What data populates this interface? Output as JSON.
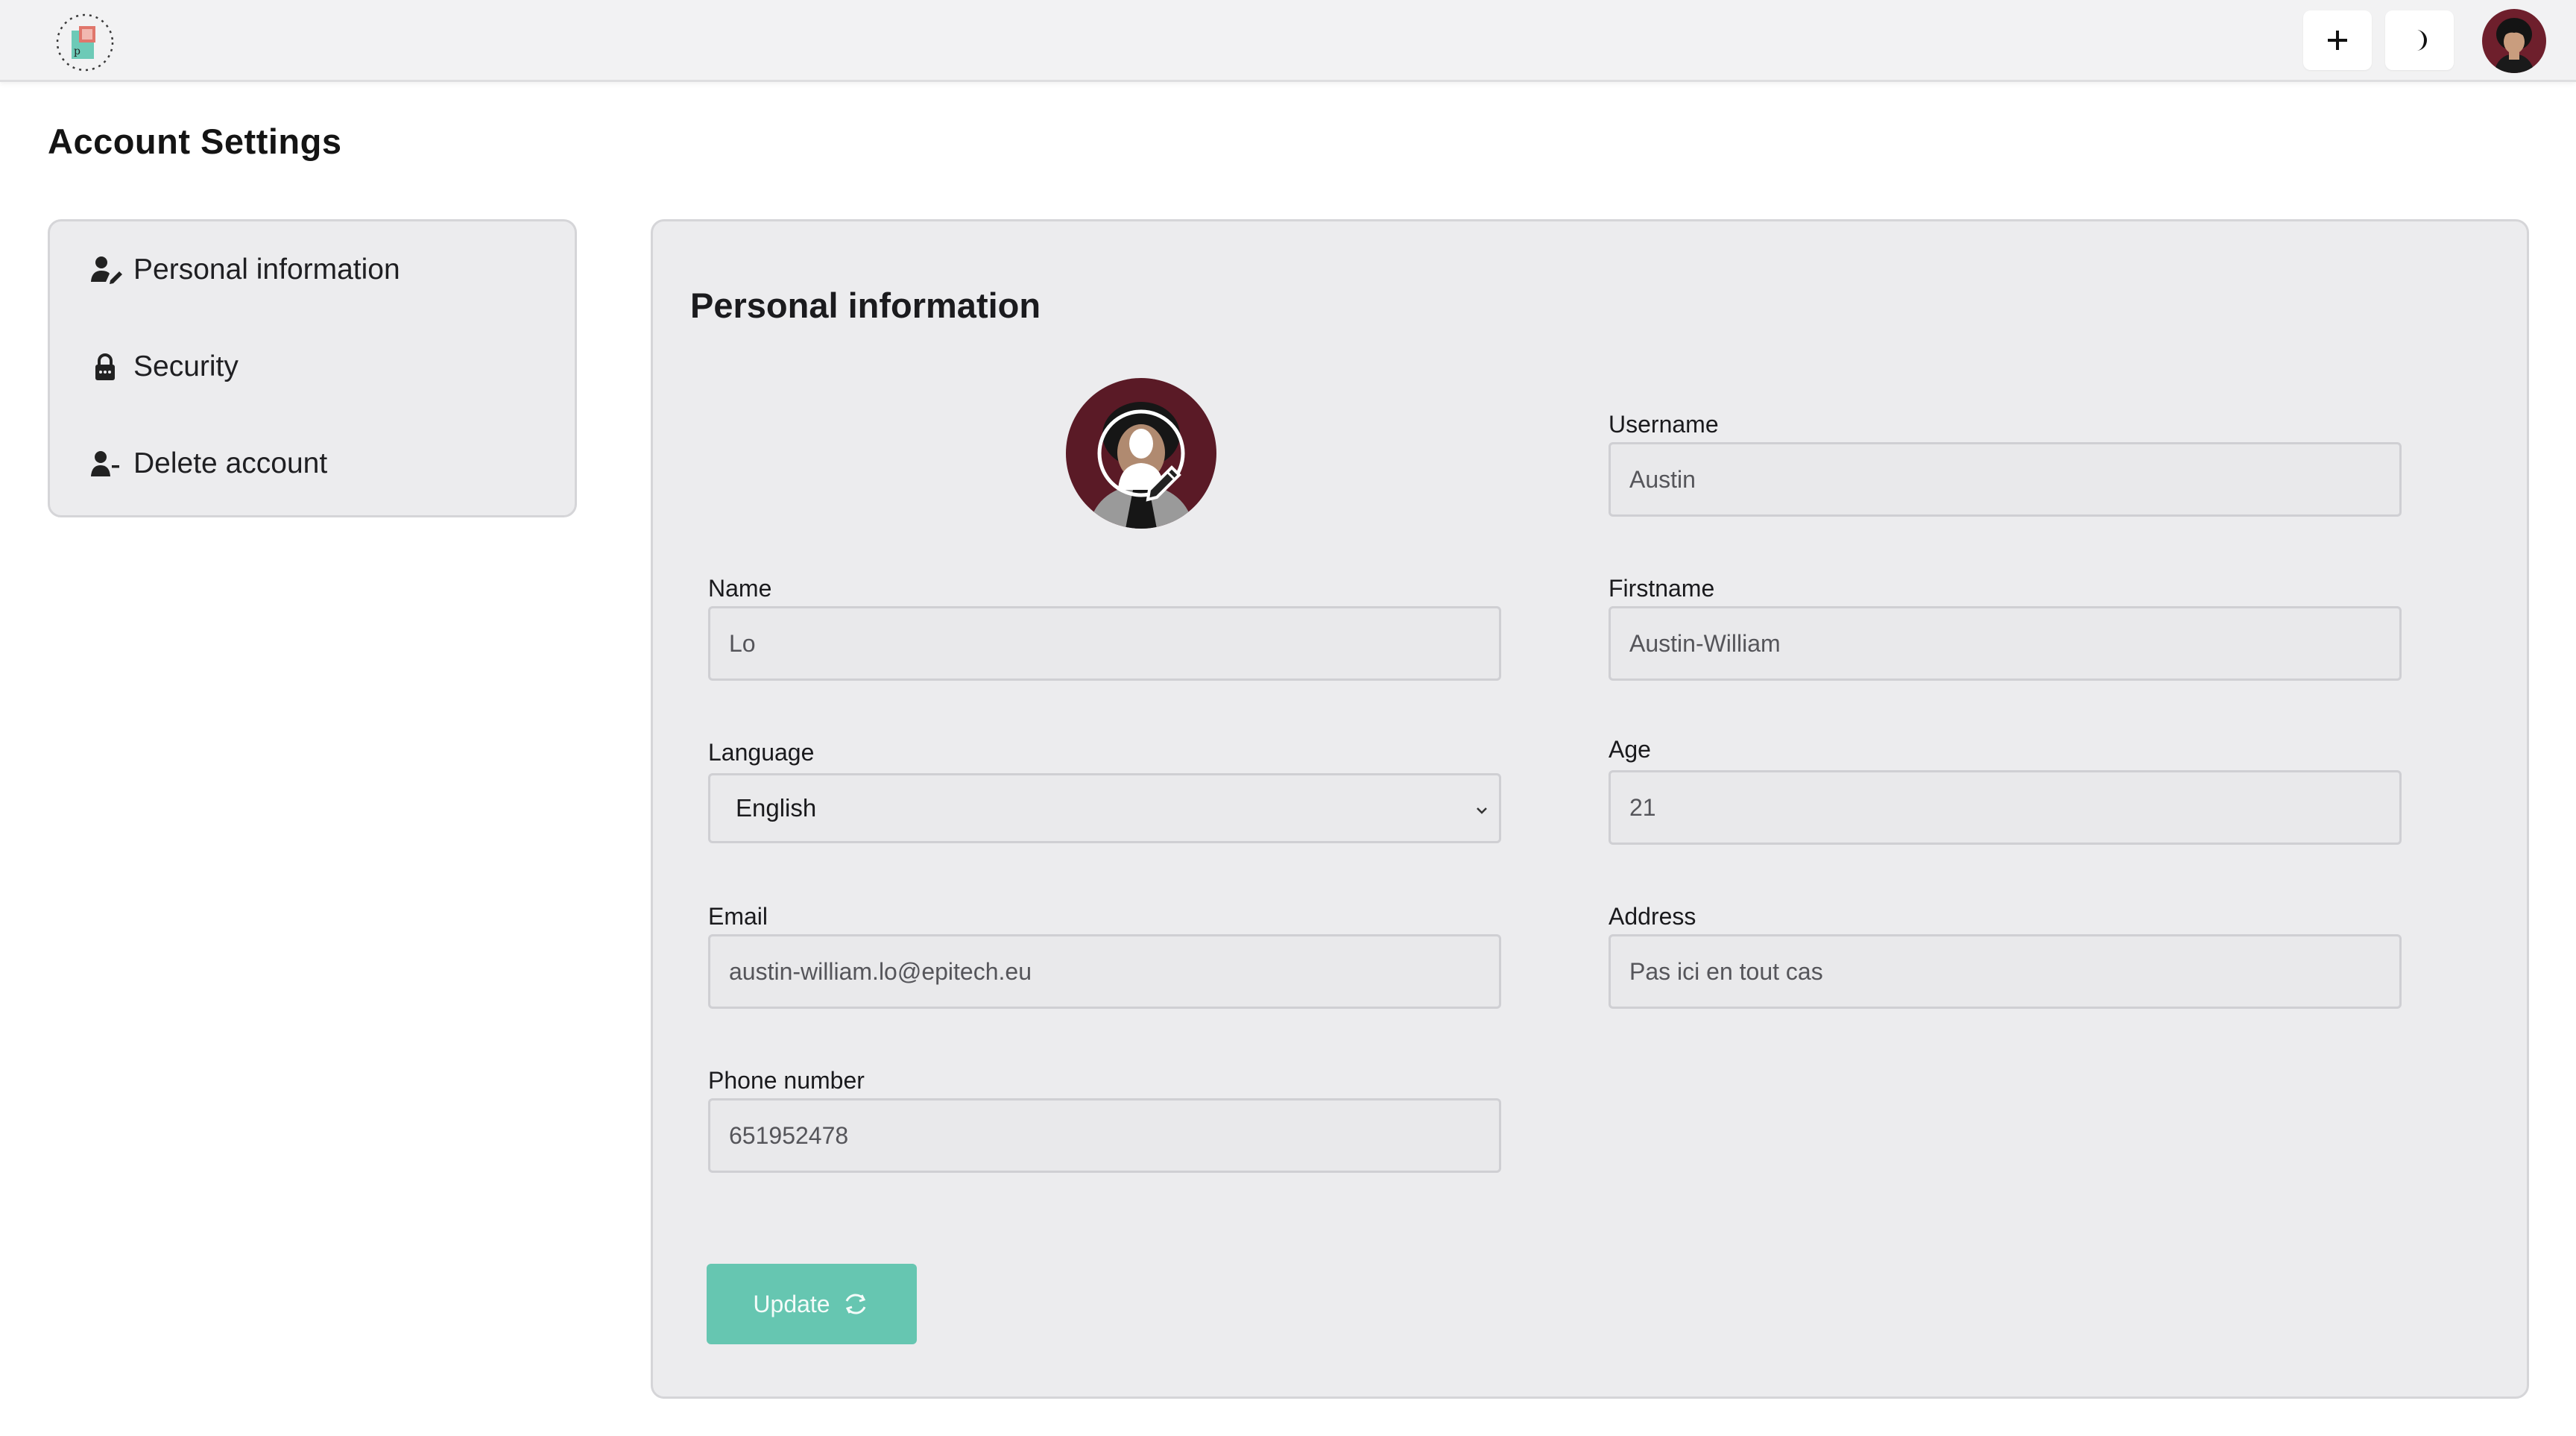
{
  "header": {
    "logo_icon": "app-logo-icon",
    "add_icon": "plus-icon",
    "theme_icon": "moon-icon",
    "avatar_icon": "user-avatar"
  },
  "page": {
    "title": "Account Settings"
  },
  "sidebar": {
    "items": [
      {
        "label": "Personal information",
        "icon": "user-edit-icon"
      },
      {
        "label": "Security",
        "icon": "lock-icon"
      },
      {
        "label": "Delete account",
        "icon": "user-minus-icon"
      }
    ]
  },
  "form": {
    "title": "Personal information",
    "fields": {
      "username": {
        "label": "Username",
        "value": "Austin"
      },
      "name": {
        "label": "Name",
        "value": "Lo"
      },
      "firstname": {
        "label": "Firstname",
        "value": "Austin-William"
      },
      "language": {
        "label": "Language",
        "value": "English"
      },
      "age": {
        "label": "Age",
        "value": "21"
      },
      "email": {
        "label": "Email",
        "value": "austin-william.lo@epitech.eu"
      },
      "address": {
        "label": "Address",
        "value": "Pas ici en tout cas"
      },
      "phone": {
        "label": "Phone number",
        "value": "651952478"
      }
    },
    "update_label": "Update"
  },
  "colors": {
    "accent": "#66c6b1",
    "card_bg": "#ececee",
    "topbar_bg": "#f2f2f3",
    "avatar_bg": "#5a1a26"
  }
}
